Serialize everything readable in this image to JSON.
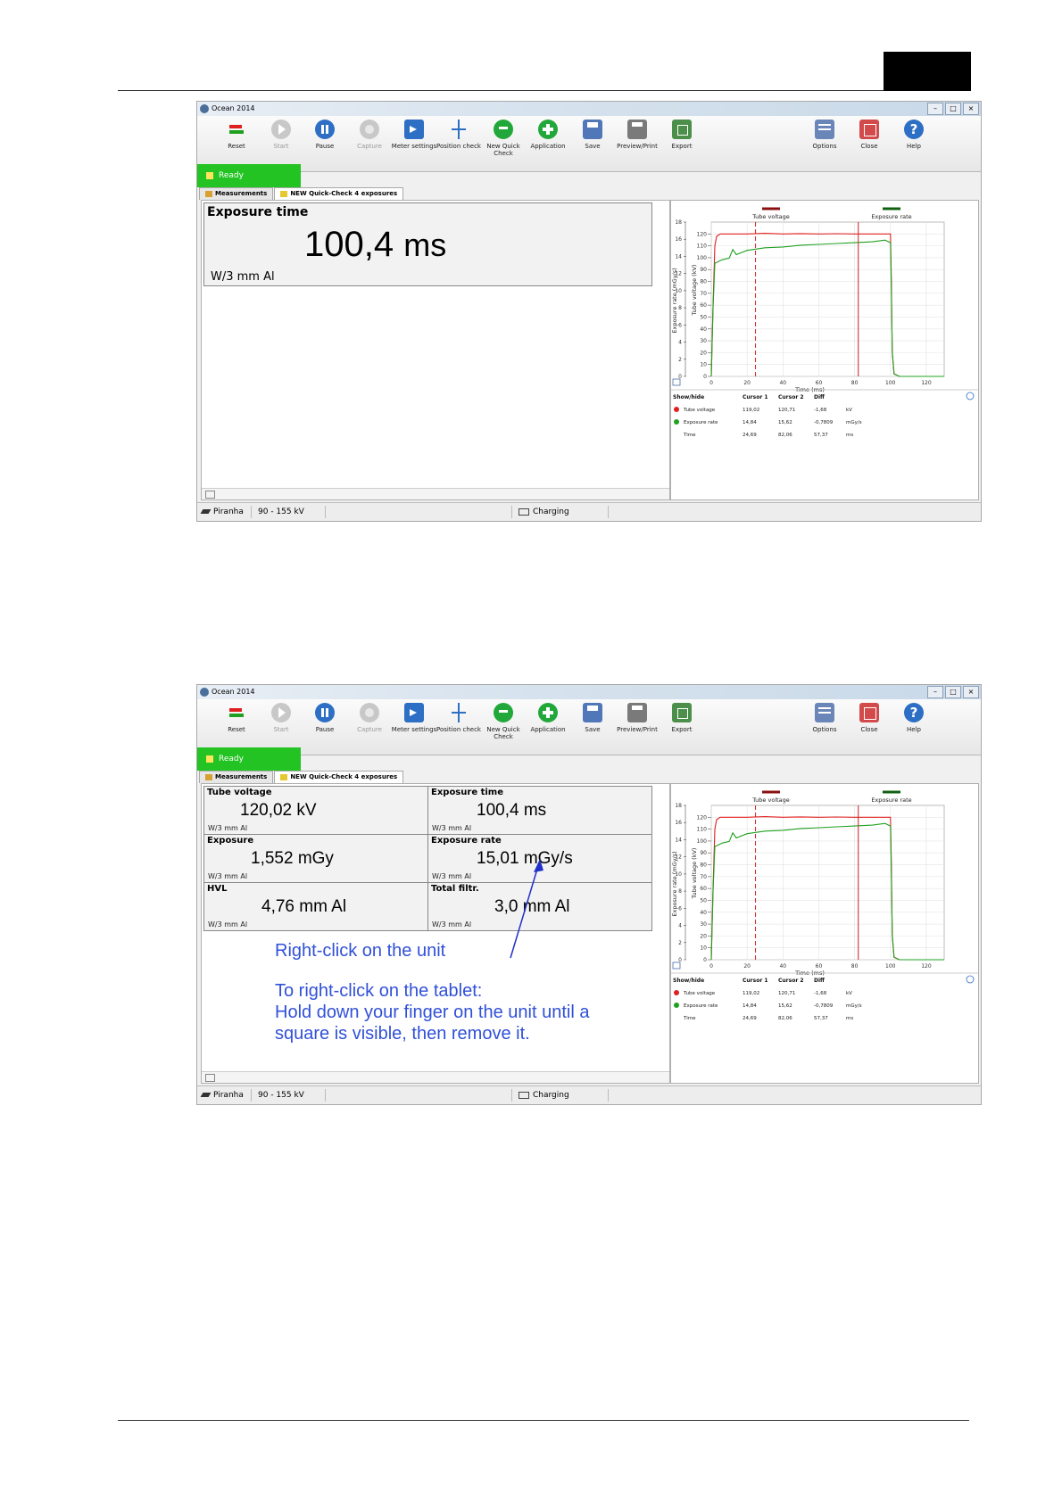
{
  "toolbar": {
    "buttons": [
      {
        "label": "Reset",
        "icon": "reset-icon"
      },
      {
        "label": "Start",
        "icon": "start-icon"
      },
      {
        "label": "Pause",
        "icon": "pause-icon"
      },
      {
        "label": "Capture",
        "icon": "capture-icon"
      },
      {
        "label": "Meter settings",
        "icon": "meter-settings-icon"
      },
      {
        "label": "Position check",
        "icon": "position-check-icon"
      },
      {
        "label": "New Quick Check",
        "icon": "new-quick-check-icon"
      },
      {
        "label": "Application",
        "icon": "application-icon"
      },
      {
        "label": "Save",
        "icon": "save-icon"
      },
      {
        "label": "Preview/Print",
        "icon": "print-icon"
      },
      {
        "label": "Export",
        "icon": "export-icon"
      },
      {
        "label": "Options",
        "icon": "options-icon"
      },
      {
        "label": "Close",
        "icon": "close-icon"
      },
      {
        "label": "Help",
        "icon": "help-icon"
      }
    ]
  },
  "window": {
    "title": "Ocean 2014"
  },
  "status": {
    "ready": "Ready"
  },
  "tabs": [
    {
      "label": "Measurements"
    },
    {
      "label": "NEW Quick-Check 4 exposures"
    }
  ],
  "shot1": {
    "measurement": {
      "label": "Exposure time",
      "value": "100,4",
      "unit": "ms",
      "filter": "W/3 mm Al"
    }
  },
  "shot2": {
    "cells": [
      {
        "label": "Tube voltage",
        "value": "120,02 kV",
        "filter": "W/3 mm Al"
      },
      {
        "label": "Exposure time",
        "value": "100,4 ms",
        "filter": "W/3 mm Al"
      },
      {
        "label": "Exposure",
        "value": "1,552 mGy",
        "filter": "W/3 mm Al"
      },
      {
        "label": "Exposure rate",
        "value": "15,01 mGy/s",
        "filter": "W/3 mm Al"
      },
      {
        "label": "HVL",
        "value": "4,76 mm Al",
        "filter": "W/3 mm Al"
      },
      {
        "label": "Total filtr.",
        "value": "3,0 mm Al",
        "filter": "W/3 mm Al"
      }
    ],
    "annotation": {
      "line1": "Right-click on the unit",
      "line2": "To right-click on the tablet:",
      "line3": "Hold down your finger on the unit until a",
      "line4": "square is visible, then remove it."
    }
  },
  "chart_data": {
    "type": "line",
    "xlabel": "Time (ms)",
    "ylabel_left": "Exposure rate (mGy/s)",
    "ylabel_right": "Tube voltage (kV)",
    "xlim": [
      0,
      130
    ],
    "x_ticks": [
      "0",
      "20",
      "40",
      "60",
      "80",
      "100",
      "120"
    ],
    "ylim_left": [
      0,
      18
    ],
    "y_ticks_left": [
      "0",
      "2",
      "4",
      "6",
      "8",
      "10",
      "12",
      "14",
      "16",
      "18"
    ],
    "ylim_right": [
      0,
      130
    ],
    "y_ticks_right": [
      "0",
      "10",
      "20",
      "30",
      "40",
      "50",
      "60",
      "70",
      "80",
      "90",
      "100",
      "110",
      "120"
    ],
    "grid": true,
    "legend_placement": "top",
    "series": [
      {
        "name": "Tube voltage",
        "color": "#e02020",
        "axis": "right",
        "x": [
          0,
          1,
          2,
          3,
          5,
          10,
          20,
          30,
          40,
          50,
          60,
          70,
          80,
          90,
          100,
          100.5,
          101,
          102,
          105,
          120,
          130
        ],
        "y": [
          0,
          60,
          110,
          118,
          120,
          120,
          120,
          120.5,
          120,
          120.3,
          120,
          120.2,
          120,
          120,
          120,
          80,
          20,
          2,
          0,
          0,
          0
        ]
      },
      {
        "name": "Exposure rate",
        "color": "#20a020",
        "axis": "left",
        "x": [
          0,
          1,
          2,
          4,
          6,
          10,
          12,
          14,
          15,
          20,
          30,
          40,
          50,
          60,
          70,
          80,
          90,
          97,
          100,
          100.5,
          101,
          102,
          105,
          120,
          130
        ],
        "y": [
          0,
          8,
          13.2,
          13.4,
          13.6,
          13.8,
          14.8,
          14.2,
          14.3,
          14.7,
          15.0,
          15.1,
          15.3,
          15.4,
          15.5,
          15.6,
          15.7,
          15.9,
          15.6,
          10,
          3,
          0.3,
          0,
          0,
          0
        ]
      }
    ],
    "cursors": [
      {
        "name": "Cursor 1",
        "x": 24.69,
        "style": "dashed"
      },
      {
        "name": "Cursor 2",
        "x": 82.06,
        "style": "solid"
      }
    ],
    "table": {
      "headers": [
        "Show/hide",
        "Cursor 1",
        "Cursor 2",
        "Diff",
        ""
      ],
      "rows": [
        {
          "name": "Tube voltage",
          "c1": "119,02",
          "c2": "120,71",
          "diff": "-1,68",
          "unit": "kV",
          "color": "#e02020"
        },
        {
          "name": "Exposure rate",
          "c1": "14,84",
          "c2": "15,62",
          "diff": "-0,7809",
          "unit": "mGy/s",
          "color": "#20a020"
        },
        {
          "name": "Time",
          "c1": "24,69",
          "c2": "82,06",
          "diff": "57,37",
          "unit": "ms",
          "color": ""
        }
      ]
    }
  },
  "bottombar": {
    "device": "Piranha",
    "range": "90 - 155 kV",
    "battery": "Charging"
  }
}
